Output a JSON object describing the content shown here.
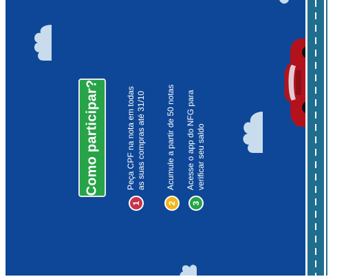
{
  "title": "Como participar?",
  "steps": [
    {
      "number": "1",
      "line1": "Peça CPF na nota em todas",
      "line2": "as suas compras até 31/10",
      "color": "#c8344a"
    },
    {
      "number": "2",
      "line1": "Acumule a partir de 50 notas",
      "line2": "",
      "color": "#f2b51b"
    },
    {
      "number": "3",
      "line1": "Acesse o app do NFG para",
      "line2": "verificar seu saldo",
      "color": "#27a348"
    }
  ],
  "colors": {
    "background": "#0e4797",
    "road": "#1f6e8f",
    "car": "#b3121d",
    "cloud": "#c9dcee"
  }
}
